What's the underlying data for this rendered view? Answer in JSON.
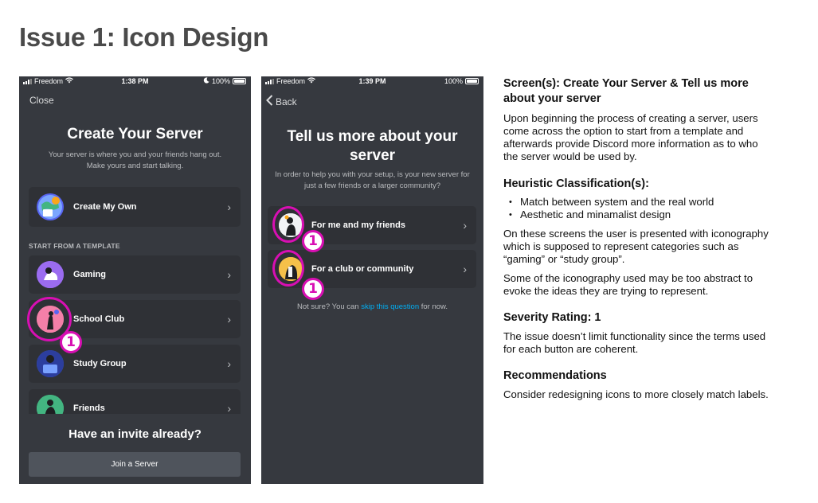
{
  "slide_title": "Issue 1: Icon Design",
  "phone1": {
    "status": {
      "carrier": "Freedom",
      "time": "1:38 PM",
      "battery": "100%"
    },
    "close_label": "Close",
    "title": "Create Your Server",
    "subtitle_line1": "Your server is where you and your friends hang out.",
    "subtitle_line2": "Make yours and start talking.",
    "create_own_label": "Create My Own",
    "section_label": "START FROM A TEMPLATE",
    "templates": [
      {
        "label": "Gaming",
        "icon": "gaming-icon",
        "color": "#8b5cf6"
      },
      {
        "label": "School Club",
        "icon": "school-club-icon",
        "color": "#f47fa8"
      },
      {
        "label": "Study Group",
        "icon": "study-group-icon",
        "color": "#3b5bdb"
      },
      {
        "label": "Friends",
        "icon": "friends-icon",
        "color": "#43b581"
      }
    ],
    "invite_title": "Have an invite already?",
    "join_label": "Join a Server",
    "callout_number": "1"
  },
  "phone2": {
    "status": {
      "carrier": "Freedom",
      "time": "1:39 PM",
      "battery": "100%"
    },
    "back_label": "Back",
    "title_line1": "Tell us more about your",
    "title_line2": "server",
    "subtitle_line1": "In order to help you with your setup, is your new server for",
    "subtitle_line2": "just a few friends or a larger community?",
    "options": [
      {
        "label": "For me and my friends",
        "icon": "friends-option-icon"
      },
      {
        "label": "For a club or community",
        "icon": "community-option-icon"
      }
    ],
    "not_sure_prefix": "Not sure? You can ",
    "not_sure_link": "skip this question",
    "not_sure_suffix": " for now.",
    "callout_number": "1"
  },
  "notes": {
    "screens_heading_line1": "Screen(s): Create Your Server & Tell us more",
    "screens_heading_line2": "about your server",
    "screens_body_line1": "Upon beginning the process of creating a server, users",
    "screens_body_line2": "come across the option to start from a template and",
    "screens_body_line3": "afterwards provide Discord more information as to who",
    "screens_body_line4": "the server would be used by.",
    "heuristic_heading": "Heuristic Classification(s):",
    "heuristics": [
      "Match between system and the real world",
      "Aesthetic and minamalist design"
    ],
    "heuristic_body1_line1": "On these screens the user is presented with iconography",
    "heuristic_body1_line2": "which is supposed to represent categories such as",
    "heuristic_body1_line3": "“gaming” or “study group”.",
    "heuristic_body2_line1": "Some of the iconography used may be too abstract to",
    "heuristic_body2_line2": "evoke the ideas they are trying to represent.",
    "severity_heading": "Severity Rating: 1",
    "severity_body_line1": "The issue doesn’t limit functionality since the terms used",
    "severity_body_line2": "for each button are coherent.",
    "recommendations_heading": "Recommendations",
    "recommendations_body": "Consider redesigning icons to more closely match labels."
  },
  "colors": {
    "accent_callout": "#d80fb3",
    "app_bg": "#36393f",
    "row_bg": "#2f3136",
    "link": "#00aff4"
  }
}
